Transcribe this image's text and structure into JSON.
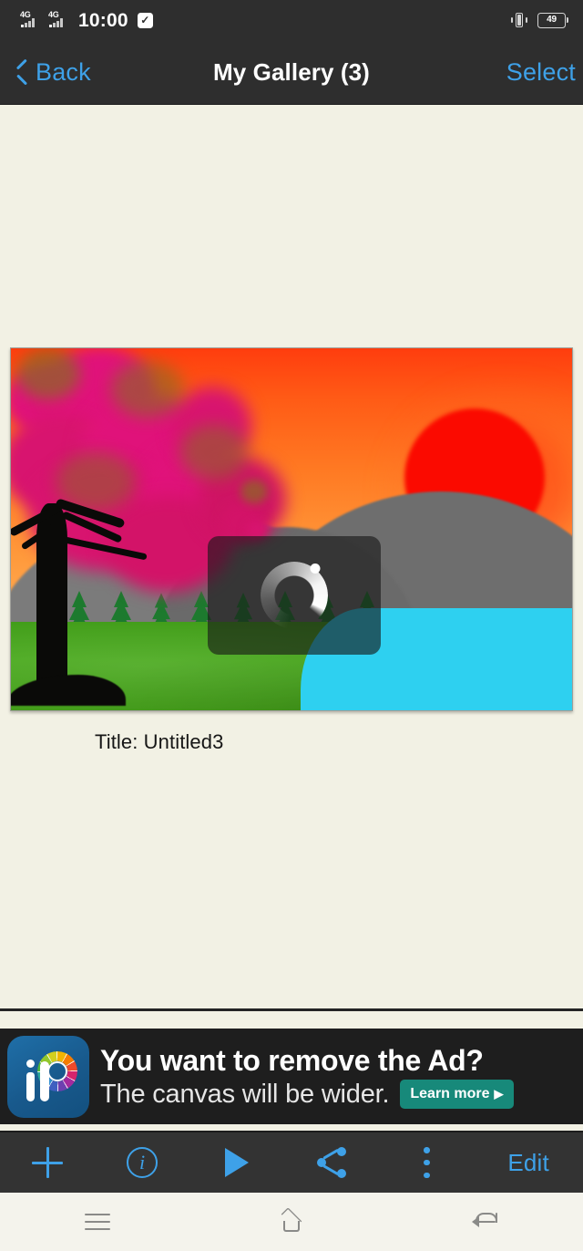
{
  "status_bar": {
    "network_1": "4G",
    "network_2": "4G",
    "time": "10:00",
    "badge_icon": "checkmark-badge",
    "vibrate_icon": "vibrate-icon",
    "battery_level": "49"
  },
  "nav": {
    "back_label": "Back",
    "title": "My Gallery (3)",
    "select_label": "Select"
  },
  "gallery": {
    "item_title": "Title: Untitled3",
    "artwork_alt": "sunset landscape with cherry blossom tree, mountain and lake",
    "signature": "",
    "loading": true,
    "loading_icon": "loading-spinner"
  },
  "ad": {
    "logo_icon": "ibis-paint-logo",
    "headline": "You want to remove the Ad?",
    "subline": "The canvas will be wider.",
    "cta_label": "Learn more",
    "cta_arrow": "▶",
    "cta_color": "#17897a"
  },
  "toolbar": {
    "add_icon": "plus-icon",
    "info_icon": "info-icon",
    "play_icon": "play-icon",
    "share_icon": "share-icon",
    "more_icon": "more-vertical-icon",
    "edit_label": "Edit",
    "accent_color": "#3ea1e8"
  },
  "android_nav": {
    "recents_icon": "menu-icon",
    "home_icon": "home-icon",
    "back_icon": "back-arrow-icon"
  },
  "colors": {
    "bar_background": "#2e2e2e",
    "page_background": "#f2f1e4",
    "accent": "#3ea1e8",
    "toolbar_background": "#333333",
    "ad_background": "#1e1e1e"
  }
}
